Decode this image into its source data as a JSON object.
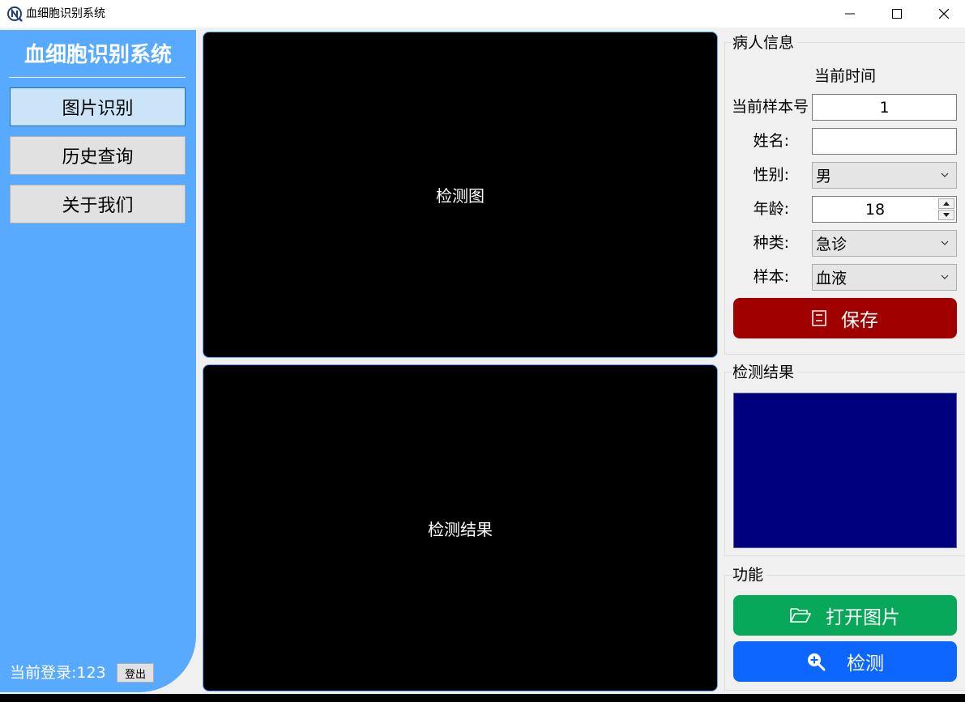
{
  "window": {
    "title": "血细胞识别系统",
    "icon": "app-logo-icon",
    "controls": [
      "minimize-icon",
      "maximize-icon",
      "close-icon"
    ]
  },
  "sidebar": {
    "title": "血细胞识别系统",
    "nav": [
      {
        "label": "图片识别",
        "active": true
      },
      {
        "label": "历史查询",
        "active": false
      },
      {
        "label": "关于我们",
        "active": false
      }
    ],
    "login_text": "当前登录:123",
    "logout_label": "登出",
    "background_color": "#57aaff"
  },
  "canvases": {
    "detect_image_label": "检测图",
    "detect_result_label": "检测结果"
  },
  "patient_info": {
    "group_title": "病人信息",
    "current_time_label": "当前时间",
    "sample_no_label": "当前样本号",
    "sample_no_value": "1",
    "name_label": "姓名:",
    "name_value": "",
    "gender_label": "性别:",
    "gender_value": "男",
    "age_label": "年龄:",
    "age_value": "18",
    "category_label": "种类:",
    "category_value": "急诊",
    "sample_label": "样本:",
    "sample_value": "血液",
    "save_label": "保存",
    "save_icon": "save-icon",
    "save_color": "#a00000"
  },
  "result_group": {
    "title": "检测结果",
    "box_color": "#00007f"
  },
  "functions": {
    "title": "功能",
    "open_label": "打开图片",
    "open_icon": "folder-open-icon",
    "open_color": "#07a85a",
    "detect_label": "检测",
    "detect_icon": "zoom-in-icon",
    "detect_color": "#0d66ff"
  }
}
